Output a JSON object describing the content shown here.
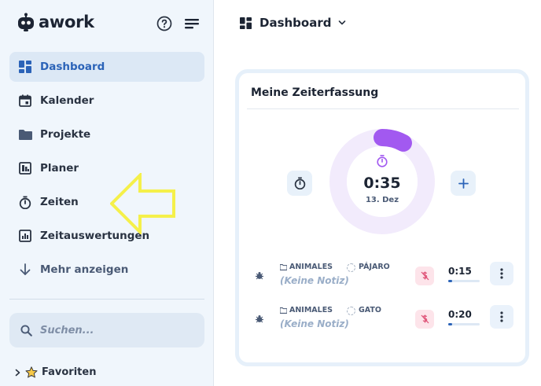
{
  "app": {
    "name": "awork"
  },
  "sidebar": {
    "items": [
      {
        "label": "Dashboard",
        "icon": "dashboard-icon",
        "active": true
      },
      {
        "label": "Kalender",
        "icon": "calendar-icon"
      },
      {
        "label": "Projekte",
        "icon": "folder-icon"
      },
      {
        "label": "Planer",
        "icon": "planner-icon"
      },
      {
        "label": "Zeiten",
        "icon": "stopwatch-icon"
      },
      {
        "label": "Zeitauswertungen",
        "icon": "chart-icon"
      },
      {
        "label": "Mehr anzeigen",
        "icon": "arrow-down-icon"
      }
    ],
    "search": {
      "placeholder": "Suchen..."
    },
    "favorites": {
      "label": "Favoriten"
    }
  },
  "header": {
    "title": "Dashboard"
  },
  "widget": {
    "title": "Meine Zeiterfassung",
    "timer": {
      "time": "0:35",
      "date": "13. Dez",
      "progress": 0.08
    },
    "entries": [
      {
        "project": "ANIMALES",
        "task": "PÁJARO",
        "note": "(Keine Notiz)",
        "duration": "0:15",
        "progress": 0.12
      },
      {
        "project": "ANIMALES",
        "task": "GATO",
        "note": "(Keine Notiz)",
        "duration": "0:20",
        "progress": 0.12
      }
    ]
  },
  "colors": {
    "accent": "#2b63b8",
    "timer_purple": "#a259f0",
    "ring_bg": "#f2ebfc",
    "annotation_arrow": "#f5f04a"
  }
}
